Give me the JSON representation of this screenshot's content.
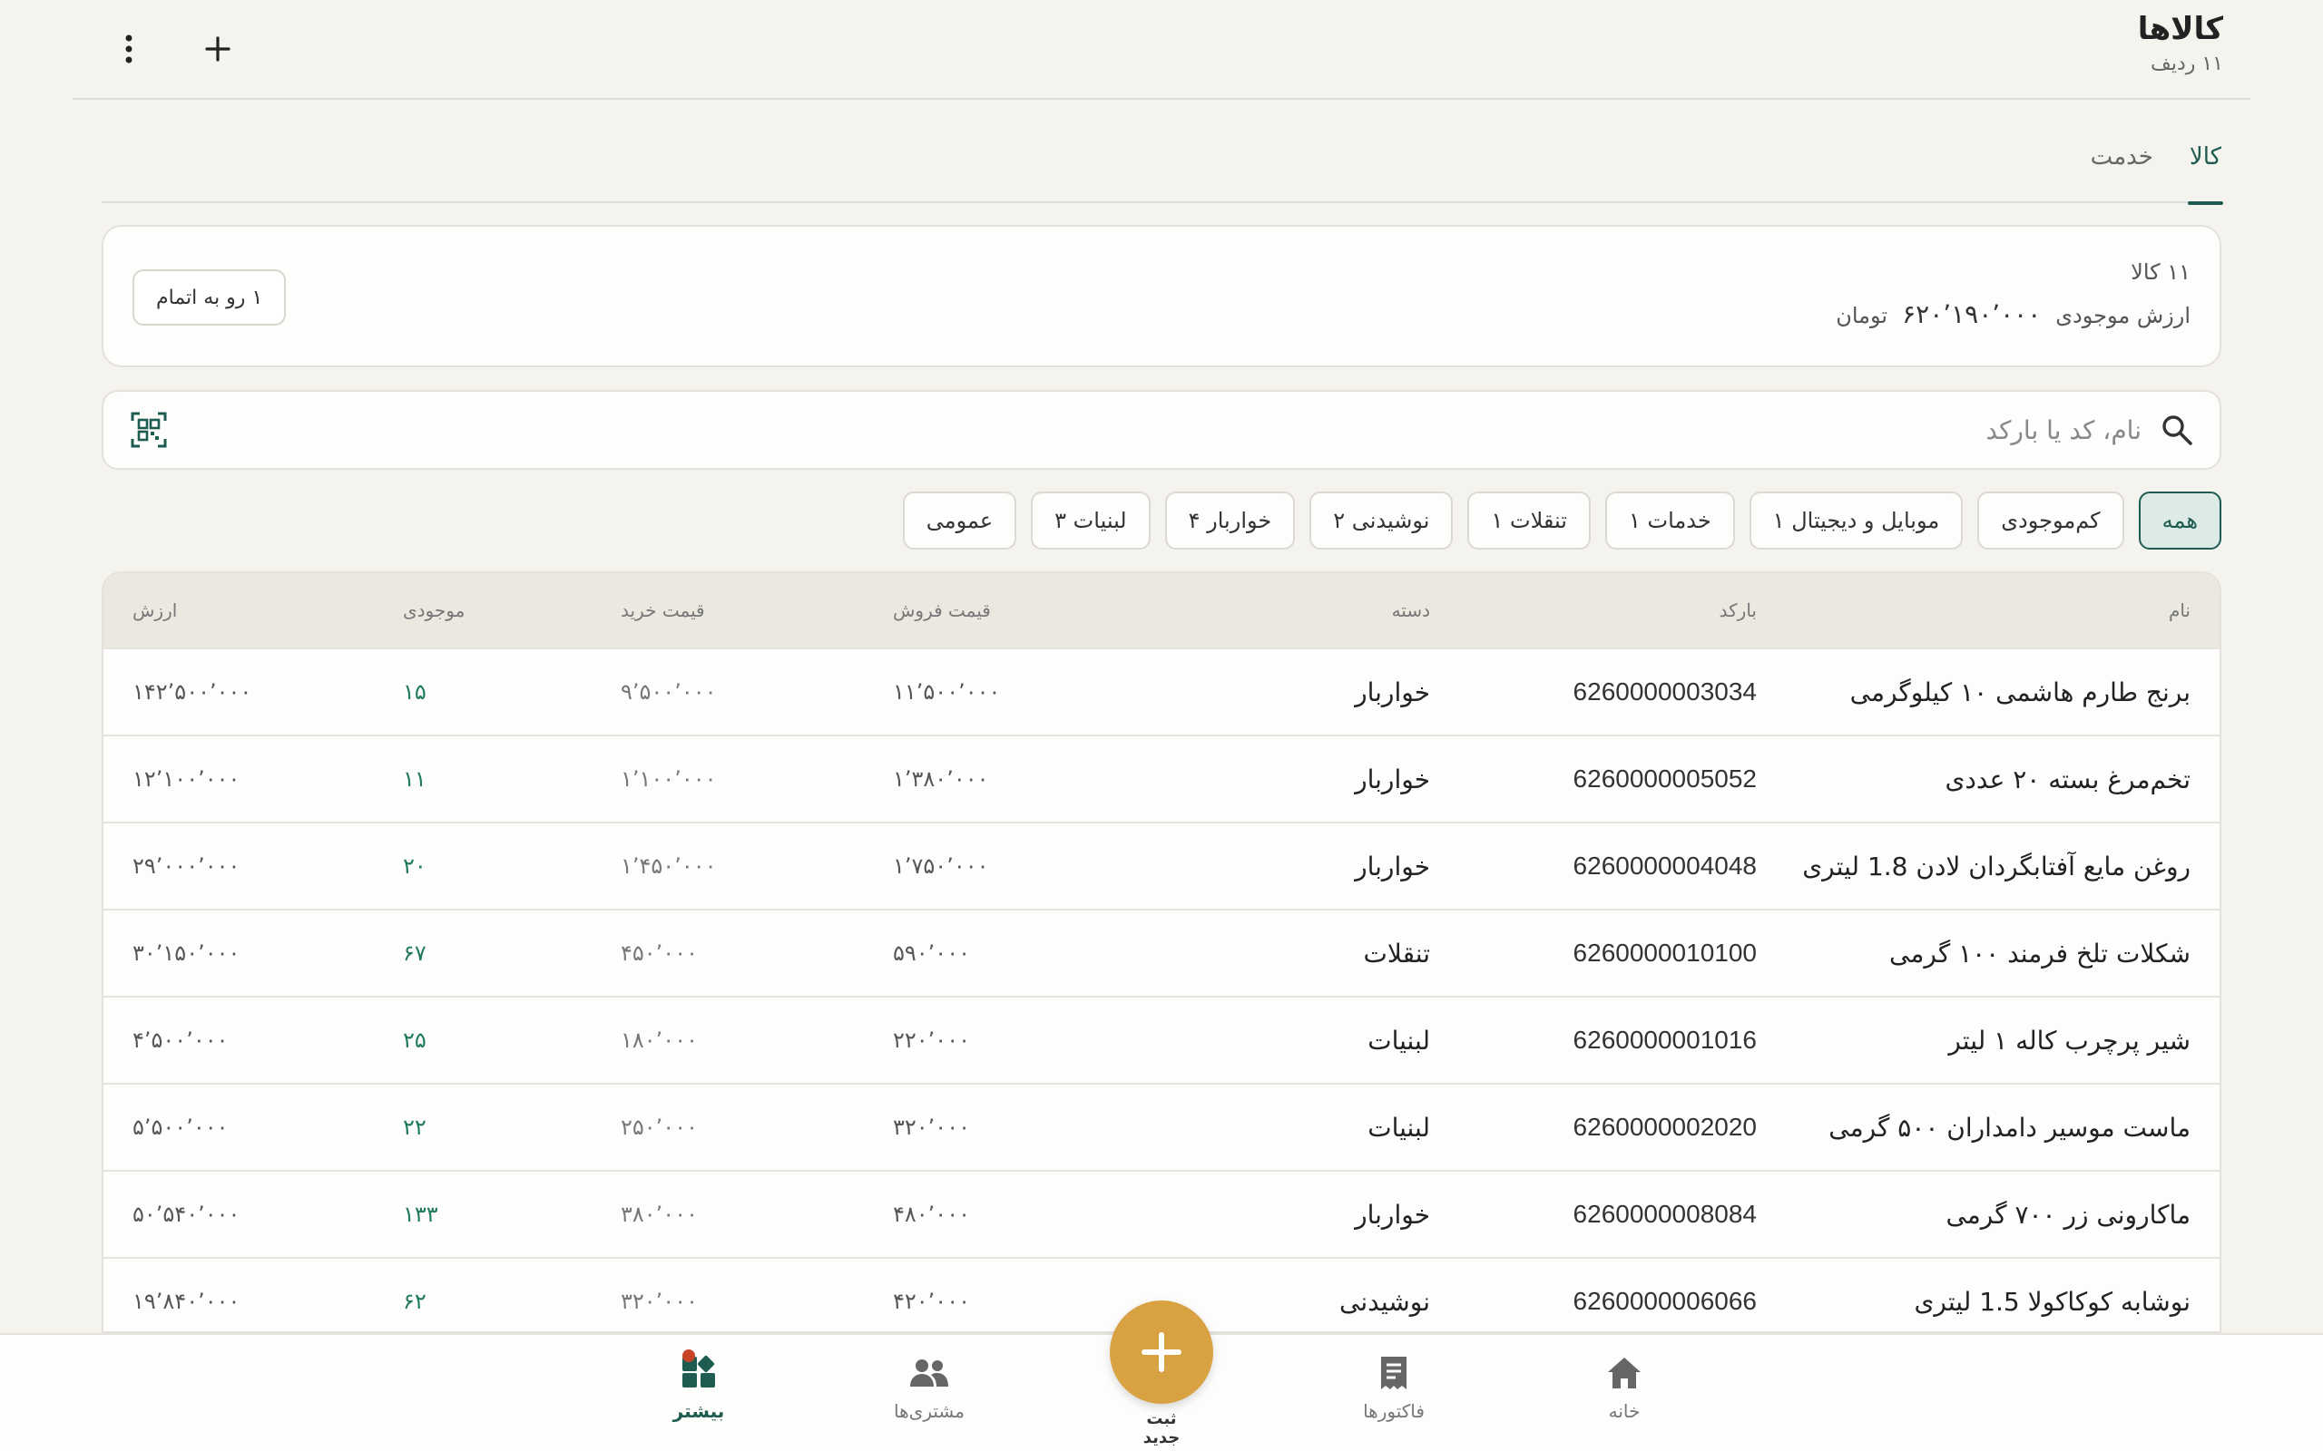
{
  "header": {
    "title": "کالاها",
    "row_count": "۱۱ ردیف"
  },
  "tabs": [
    {
      "label": "کالا",
      "active": true
    },
    {
      "label": "خدمت",
      "active": false
    }
  ],
  "summary": {
    "count": "۱۱ کالا",
    "value_label": "ارزش موجودی",
    "value": "۶۲۰٬۱۹۰٬۰۰۰",
    "currency": "تومان",
    "low_stock_pill": "۱ رو به اتمام"
  },
  "search": {
    "placeholder": "نام، کد یا بارکد"
  },
  "chips": [
    {
      "label": "همه",
      "active": true
    },
    {
      "label": "کم‌موجودی"
    },
    {
      "label": "موبایل و دیجیتال ۱"
    },
    {
      "label": "خدمات ۱"
    },
    {
      "label": "تنقلات ۱"
    },
    {
      "label": "نوشیدنی ۲"
    },
    {
      "label": "خواربار ۴"
    },
    {
      "label": "لبنیات ۳"
    },
    {
      "label": "عمومی"
    }
  ],
  "table": {
    "headers": {
      "name": "نام",
      "barcode": "بارکد",
      "category": "دسته",
      "sell_price": "قیمت فروش",
      "buy_price": "قیمت خرید",
      "stock": "موجودی",
      "value": "ارزش"
    },
    "rows": [
      {
        "name": "برنج طارم هاشمی ۱۰ کیلوگرمی",
        "barcode": "6260000003034",
        "category": "خواربار",
        "sell": "۱۱٬۵۰۰٬۰۰۰",
        "buy": "۹٬۵۰۰٬۰۰۰",
        "stock": "۱۵",
        "value": "۱۴۲٬۵۰۰٬۰۰۰"
      },
      {
        "name": "تخم‌مرغ بسته ۲۰ عددی",
        "barcode": "6260000005052",
        "category": "خواربار",
        "sell": "۱٬۳۸۰٬۰۰۰",
        "buy": "۱٬۱۰۰٬۰۰۰",
        "stock": "۱۱",
        "value": "۱۲٬۱۰۰٬۰۰۰"
      },
      {
        "name": "روغن مایع آفتابگردان لادن 1.8 لیتری",
        "barcode": "6260000004048",
        "category": "خواربار",
        "sell": "۱٬۷۵۰٬۰۰۰",
        "buy": "۱٬۴۵۰٬۰۰۰",
        "stock": "۲۰",
        "value": "۲۹٬۰۰۰٬۰۰۰"
      },
      {
        "name": "شکلات تلخ فرمند ۱۰۰ گرمی",
        "barcode": "6260000010100",
        "category": "تنقلات",
        "sell": "۵۹۰٬۰۰۰",
        "buy": "۴۵۰٬۰۰۰",
        "stock": "۶۷",
        "value": "۳۰٬۱۵۰٬۰۰۰"
      },
      {
        "name": "شیر پرچرب کاله ۱ لیتر",
        "barcode": "6260000001016",
        "category": "لبنیات",
        "sell": "۲۲۰٬۰۰۰",
        "buy": "۱۸۰٬۰۰۰",
        "stock": "۲۵",
        "value": "۴٬۵۰۰٬۰۰۰"
      },
      {
        "name": "ماست موسیر دامداران ۵۰۰ گرمی",
        "barcode": "6260000002020",
        "category": "لبنیات",
        "sell": "۳۲۰٬۰۰۰",
        "buy": "۲۵۰٬۰۰۰",
        "stock": "۲۲",
        "value": "۵٬۵۰۰٬۰۰۰"
      },
      {
        "name": "ماکارونی زر ۷۰۰ گرمی",
        "barcode": "6260000008084",
        "category": "خواربار",
        "sell": "۴۸۰٬۰۰۰",
        "buy": "۳۸۰٬۰۰۰",
        "stock": "۱۳۳",
        "value": "۵۰٬۵۴۰٬۰۰۰"
      },
      {
        "name": "نوشابه کوکاکولا 1.5 لیتری",
        "barcode": "6260000006066",
        "category": "نوشیدنی",
        "sell": "۴۲۰٬۰۰۰",
        "buy": "۳۲۰٬۰۰۰",
        "stock": "۶۲",
        "value": "۱۹٬۸۴۰٬۰۰۰"
      }
    ]
  },
  "bottom_nav": {
    "home": "خانه",
    "invoices": "فاکتورها",
    "new": "ثبت جدید",
    "customers": "مشتری‌ها",
    "more": "بیشتر"
  },
  "colors": {
    "accent": "#1e5b50",
    "fab": "#d8a243",
    "background": "#f5f3ee",
    "stock_text": "#1e7a5c",
    "badge": "#c84428"
  }
}
